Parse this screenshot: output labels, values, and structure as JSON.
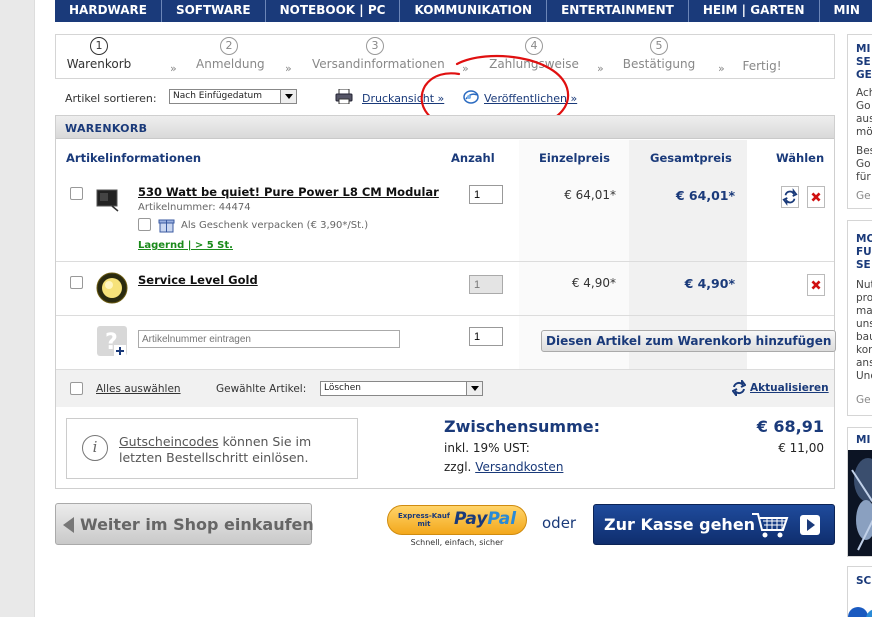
{
  "nav": {
    "items": [
      "HARDWARE",
      "SOFTWARE",
      "NOTEBOOK | PC",
      "KOMMUNIKATION",
      "ENTERTAINMENT",
      "HEIM | GARTEN",
      "MIN"
    ]
  },
  "steps": [
    {
      "num": "1",
      "label": "Warenkorb"
    },
    {
      "num": "2",
      "label": "Anmeldung"
    },
    {
      "num": "3",
      "label": "Versandinformationen"
    },
    {
      "num": "4",
      "label": "Zahlungsweise"
    },
    {
      "num": "5",
      "label": "Bestätigung"
    },
    {
      "num": "",
      "label": "Fertig!"
    }
  ],
  "step_separator": "»",
  "sort": {
    "label": "Artikel sortieren:",
    "selected": "Nach Einfügedatum",
    "print_link": "Druckansicht »",
    "publish_link": "Veröffentlichen »"
  },
  "cart": {
    "title": "WARENKORB",
    "columns": {
      "info": "Artikelinformationen",
      "qty": "Anzahl",
      "unit": "Einzelpreis",
      "total": "Gesamtpreis",
      "select": "Wählen"
    },
    "items": [
      {
        "name": "530 Watt be quiet! Pure Power L8 CM Modular",
        "artnr": "Artikelnummer: 44474",
        "gift": "Als Geschenk verpacken (€ 3,90*/St.)",
        "stock": "Lagernd | > 5 St.",
        "qty": "1",
        "unit_price": "€ 64,01*",
        "total_price": "€ 64,01*"
      },
      {
        "name": "Service Level Gold",
        "qty": "1",
        "unit_price": "€ 4,90*",
        "total_price": "€ 4,90*"
      }
    ],
    "add_row": {
      "placeholder": "Artikelnummer eintragen",
      "qty": "1",
      "button": "Diesen Artikel zum Warenkorb hinzufügen"
    },
    "footer": {
      "select_all": "Alles auswählen",
      "selected_label": "Gewählte Artikel:",
      "action": "Löschen",
      "update": "Aktualisieren"
    },
    "coupon": {
      "link": "Gutscheincodes",
      "line1_rest": " können Sie im",
      "line2": "letzten Bestellschritt einlösen."
    },
    "summary": {
      "subtotal_label": "Zwischensumme:",
      "subtotal": "€ 68,91",
      "vat_label": "inkl. 19% UST:",
      "vat": "€ 11,00",
      "shipping_prefix": "zzgl. ",
      "shipping_link": "Versandkosten"
    }
  },
  "bottom": {
    "continue": "Weiter im Shop einkaufen",
    "paypal_top": "Express-Kauf",
    "paypal_mit": "mit",
    "paypal_pay": "Pay",
    "paypal_pal": "Pal",
    "paypal_tag": "Schnell, einfach, sicher",
    "or": "oder",
    "checkout": "Zur Kasse gehen"
  },
  "sidebar": {
    "box1_title": [
      "MI",
      "SE",
      "GE"
    ],
    "box1_text": [
      "Ach",
      "Go",
      "aus",
      "mö",
      "",
      "Bes",
      "Go",
      "für"
    ],
    "box1_more": "Ge",
    "box2_title": [
      "MO",
      "FU",
      "SE"
    ],
    "box2_text": [
      "Nut",
      "pro",
      "ma",
      "uns",
      "bau",
      "kor",
      "ans",
      "Und"
    ],
    "box2_more": "Ge",
    "box3_title": "MI",
    "box4_title": "SC"
  },
  "colors": {
    "brand": "#1a3a7a",
    "stock_green": "#1a8a1a",
    "annotation_red": "#e01010"
  }
}
